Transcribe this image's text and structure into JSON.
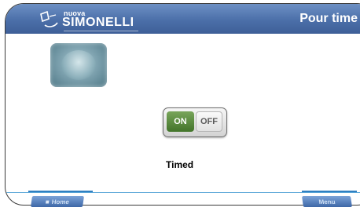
{
  "header": {
    "brand_small": "nuova",
    "brand_name": "SIMONELLI",
    "title": "Pour time"
  },
  "toggle": {
    "on_label": "ON",
    "off_label": "OFF",
    "state": "ON"
  },
  "mode_label": "Timed",
  "footer": {
    "home_label": "Home",
    "menu_label": "Menu"
  },
  "icons": {
    "logo": "simonelli-logo-icon",
    "thumb": "coffee-group-icon",
    "home": "home-icon"
  },
  "colors": {
    "header": "#4b6fa9",
    "toggle_on": "#42742a",
    "divider": "#5aa6d8"
  }
}
